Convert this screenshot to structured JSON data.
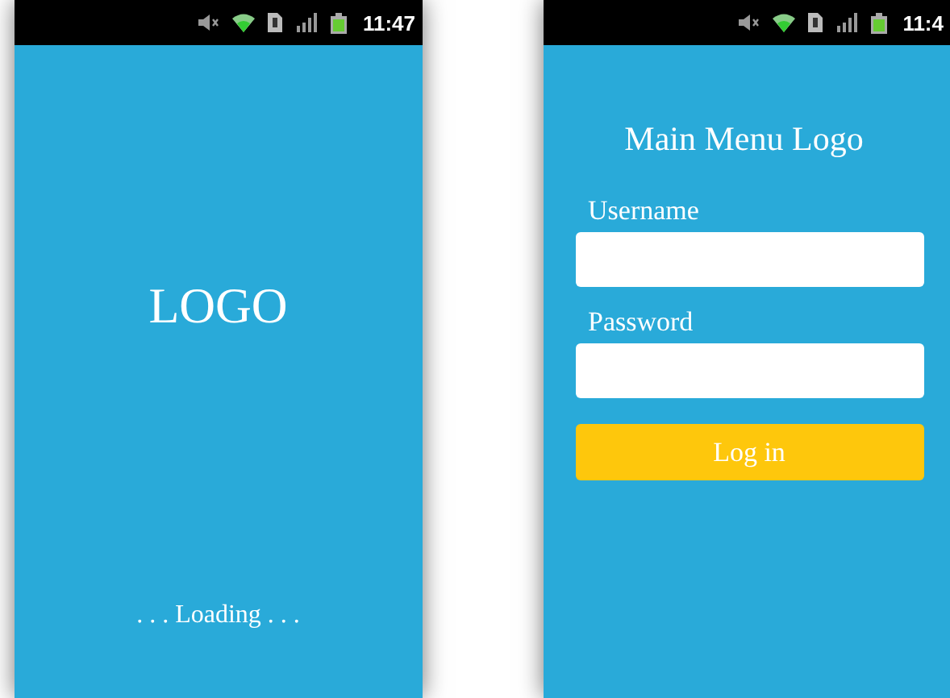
{
  "screens": [
    {
      "kind": "splash",
      "status_bar": {
        "time": "11:47"
      },
      "logo": "LOGO",
      "loading": ". . . Loading . . ."
    },
    {
      "kind": "login",
      "status_bar": {
        "time": "11:4"
      },
      "logo": "Main Menu Logo",
      "fields": [
        {
          "label": "Username"
        },
        {
          "label": "Password"
        }
      ],
      "button": "Log in"
    }
  ]
}
